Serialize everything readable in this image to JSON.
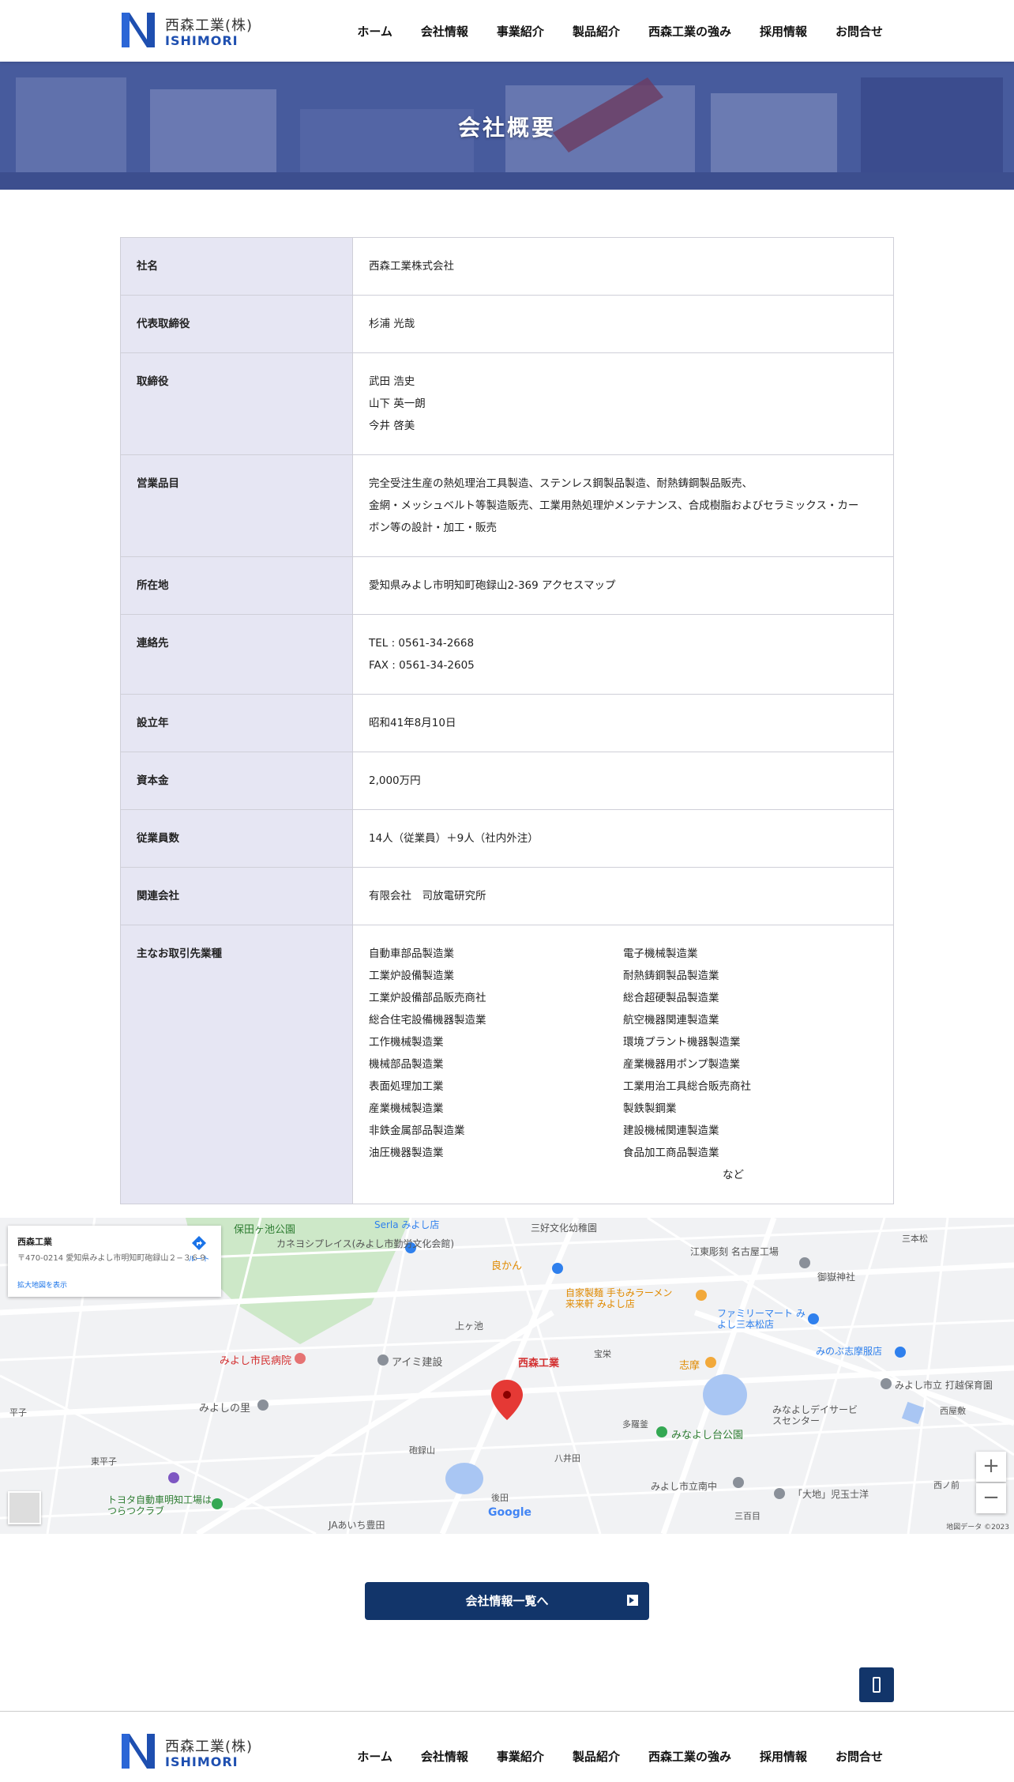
{
  "header": {
    "logo_jp": "西森工業(株)",
    "logo_en": "ISHIMORI",
    "nav": [
      "ホーム",
      "会社情報",
      "事業紹介",
      "製品紹介",
      "西森工業の強み",
      "採用情報",
      "お問合せ"
    ]
  },
  "hero": {
    "title": "会社概要"
  },
  "profile": {
    "company_name": {
      "label": "社名",
      "value": "西森工業株式会社"
    },
    "representative": {
      "label": "代表取締役",
      "value": "杉浦 光哉"
    },
    "directors": {
      "label": "取締役",
      "values": [
        "武田 浩史",
        "山下 英一朗",
        "今井 啓美"
      ]
    },
    "business": {
      "label": "営業品目",
      "values": [
        "完全受注生産の熱処理治工具製造、ステンレス鋼製品製造、耐熱鋳鋼製品販売、",
        "金網・メッシュベルト等製造販売、工業用熱処理炉メンテナンス、合成樹脂およびセラミックス・カー",
        "ボン等の設計・加工・販売"
      ]
    },
    "address": {
      "label": "所在地",
      "value": "愛知県みよし市明知町砲録山2-369 アクセスマップ"
    },
    "contact": {
      "label": "連絡先",
      "tel": "TEL : 0561-34-2668",
      "fax": "FAX : 0561-34-2605"
    },
    "founded": {
      "label": "設立年",
      "value": "昭和41年8月10日"
    },
    "capital": {
      "label": "資本金",
      "value": "2,000万円"
    },
    "employees": {
      "label": "従業員数",
      "value": "14人（従業員）＋9人（社内外注）"
    },
    "affiliate": {
      "label": "関連会社",
      "value": "有限会社　司放電研究所"
    },
    "clients": {
      "label": "主なお取引先業種",
      "left": [
        "自動車部品製造業",
        "工業炉設備製造業",
        "工業炉設備部品販売商社",
        "総合住宅設備機器製造業",
        "工作機械製造業",
        "機械部品製造業",
        "表面処理加工業",
        "産業機械製造業",
        "非鉄金属部品製造業",
        "油圧機器製造業"
      ],
      "right": [
        "電子機械製造業",
        "耐熱鋳鋼製品製造業",
        "総合超硬製品製造業",
        "航空機器関連製造業",
        "環境プラント機器製造業",
        "産業機器用ポンプ製造業",
        "工業用治工具総合販売商社",
        "製鉄製鋼業",
        "建設機械関連製造業",
        "食品加工商品製造業"
      ],
      "etc": "など"
    }
  },
  "map": {
    "card_title": "西森工業",
    "card_address": "〒470-0214 愛知県みよし市明知町砲録山２−３６９",
    "card_link": "拡大地図を表示",
    "card_directions": "ルート",
    "marker_label": "西森工業",
    "zoom_in": "+",
    "zoom_out": "−",
    "google": "Google",
    "attribution": "地図データ ©2023",
    "places": [
      "保田ヶ池公園",
      "カネヨシプレイス(みよし市勤労文化会館)",
      "三好文化幼稚園",
      "江東彫刻 名古屋工場",
      "良かん",
      "自家製麺 手もみラーメン 来来軒 みよし店",
      "ファミリーマート みよし三本松店",
      "御嶽神社",
      "上ヶ池",
      "みよし市民病院",
      "アイミ建設",
      "宝栄",
      "志摩",
      "みのぶ志摩服店",
      "みよし市立 打越保育園",
      "平子",
      "みよしの里",
      "多羅釜",
      "みなよし台公園",
      "みなよしデイサービスセンター",
      "東平子",
      "砲録山",
      "八井田",
      "トヨタ自動車明知工場はつらつクラブ",
      "JAあいち豊田",
      "後田",
      "みよし市立南中",
      "「大地」児玉士洋",
      "三百目",
      "西屋敷",
      "三本松",
      "西ノ前",
      "Serla みよし店"
    ]
  },
  "more_button": {
    "label": "会社情報一覧へ"
  },
  "footer": {
    "logo_jp": "西森工業(株)",
    "logo_en": "ISHIMORI",
    "nav": [
      "ホーム",
      "会社情報",
      "事業紹介",
      "製品紹介",
      "西森工業の強み",
      "採用情報",
      "お問合せ"
    ]
  },
  "colors": {
    "brand_navy": "#12356a",
    "logo_blue": "#1e4fb0",
    "table_header_bg": "#e6e6f3",
    "map_marker": "#e53935"
  }
}
